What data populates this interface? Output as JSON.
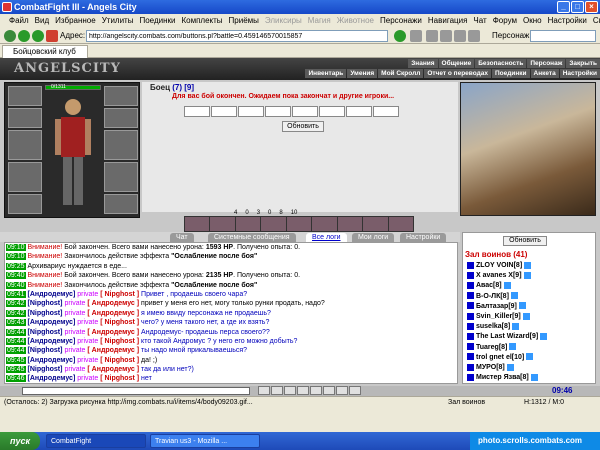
{
  "window": {
    "title": "CombatFight III - Angels City"
  },
  "menu": [
    "Файл",
    "Вид",
    "Избранное",
    "Утилиты",
    "Поединки",
    "Комплекты",
    "Приёмы",
    "Эликсиры",
    "Магия",
    "Животное",
    "Персонажи",
    "Навигация",
    "Чат",
    "Форум",
    "Окно",
    "Настройки",
    "Справка"
  ],
  "toolbar": {
    "address_label": "Адрес:",
    "address_value": "http://angelscity.combats.com/buttons.pl?battle=0.459146570015857",
    "persona_label": "Персонаж:"
  },
  "tab": {
    "label": "Бойцовский клуб"
  },
  "game": {
    "logo": "ANGELSCITY",
    "nav_top": [
      "Знания",
      "Общение",
      "Безопасность",
      "Персонаж",
      "Закрыть"
    ],
    "nav_bottom": [
      "Инвентарь",
      "Умения",
      "Мой Скролл",
      "Отчет о переводах",
      "Поединки",
      "Анкета",
      "Настройки"
    ],
    "hp": "0/1311",
    "fighter_name": "Боец",
    "fighter_level": "(7) [9]",
    "fight_message": "Для вас бой окончен. Ожидаем пока закончат и другие игроки...",
    "refresh_fight": "Обновить",
    "stats": [
      "4",
      "0",
      "3",
      "0",
      "8",
      "10"
    ]
  },
  "chat_tabs": [
    "Чат",
    "Системные сообщения",
    "Все логи",
    "Мои логи",
    "Настройки"
  ],
  "chat": [
    {
      "time": "09:10",
      "kind": "warn",
      "prefix": "Внимание!",
      "text": "Бой закончен. Всего вами нанесено урона: ",
      "bold": "1593 HP",
      "rest": ". Получено опыта: 0."
    },
    {
      "time": "09:10",
      "kind": "warn",
      "prefix": "Внимание!",
      "text": "Закончилось действие эффекта ",
      "bold": "\"Ослабление после боя\"",
      "rest": ""
    },
    {
      "time": "09:25",
      "kind": "plain",
      "prefix": "",
      "text": "Архивариус нуждается в еде...",
      "bold": "",
      "rest": ""
    },
    {
      "time": "09:40",
      "kind": "warn",
      "prefix": "Внимание!",
      "text": "Бой закончен. Всего вами нанесено урона: ",
      "bold": "2135 HP",
      "rest": ". Получено опыта: 0."
    },
    {
      "time": "09:40",
      "kind": "warn",
      "prefix": "Внимание!",
      "text": "Закончилось действие эффекта ",
      "bold": "\"Ослабление после боя\"",
      "rest": ""
    },
    {
      "time": "09:41",
      "kind": "priv",
      "from": "[Андродемус]",
      "to": "[ Nipghost ]",
      "msg": "Привет , продаешь своего чара?",
      "color": "p"
    },
    {
      "time": "09:42",
      "kind": "priv",
      "from": "[Nipghost]",
      "to": "[ Андродемус ]",
      "msg": "привет у меня его нет, могу только рунки продать, надо?",
      "color": "b"
    },
    {
      "time": "09:42",
      "kind": "priv",
      "from": "[Nipghost]",
      "to": "[ Андродемус ]",
      "msg": "я имею ввиду персонажа не продаешь?",
      "color": "p"
    },
    {
      "time": "09:43",
      "kind": "priv",
      "from": "[Андродемус]",
      "to": "[ Nipghost ]",
      "msg": "чего? у меня такого нет, а где их взять?",
      "color": "p"
    },
    {
      "time": "09:44",
      "kind": "priv",
      "from": "[Nipghost]",
      "to": "[ Андродемус ]",
      "msg": "Андродемус- продаешь перса своего??",
      "color": "p"
    },
    {
      "time": "09:44",
      "kind": "priv",
      "from": "[Андродемус]",
      "to": "[ Nipghost ]",
      "msg": "кто такой Андромус ? у него его можно добыть?",
      "color": "p"
    },
    {
      "time": "09:44",
      "kind": "priv",
      "from": "[Nipghost]",
      "to": "[ Андродемус ]",
      "msg": "ты надо мной прикалываешься?",
      "color": "p"
    },
    {
      "time": "09:45",
      "kind": "priv",
      "from": "[Андродемус]",
      "to": "[ Nipghost ]",
      "msg": "да! ;)",
      "color": "b"
    },
    {
      "time": "09:45",
      "kind": "priv",
      "from": "[Nipghost]",
      "to": "[ Андродемус ]",
      "msg": "так да или нет?)",
      "color": "p"
    },
    {
      "time": "09:46",
      "kind": "priv",
      "from": "[Андродемус]",
      "to": "[ Nipghost ]",
      "msg": "нет",
      "color": "p"
    }
  ],
  "online": {
    "refresh": "Обновить",
    "header": "Зал воинов (41)",
    "players": [
      "ZLOY VOIN[8]",
      "X avanes X[9]",
      "Авас[8]",
      "В-О-ЛК[8]",
      "Балтазар[9]",
      "Svin_Killer[9]",
      "suselka[8]",
      "The Last Wizard[9]",
      "Tuareg[8]",
      "trol gnet el[10]",
      "МУРО[8]",
      "Мистер Язва[8]"
    ]
  },
  "bottom": {
    "clock": "09:46"
  },
  "status": {
    "left": "(Осталось: 2) Загрузка рисунка http://img.combats.ru/i/items/4/body09203.gif...",
    "zone": "Зал воинов",
    "hp": "H:1312 / M:0"
  },
  "taskbar": {
    "start": "пуск",
    "tasks": [
      "CombatFight",
      "Travian us3 - Mozilla ..."
    ],
    "tray": "photo.scrolls.combats.com"
  }
}
